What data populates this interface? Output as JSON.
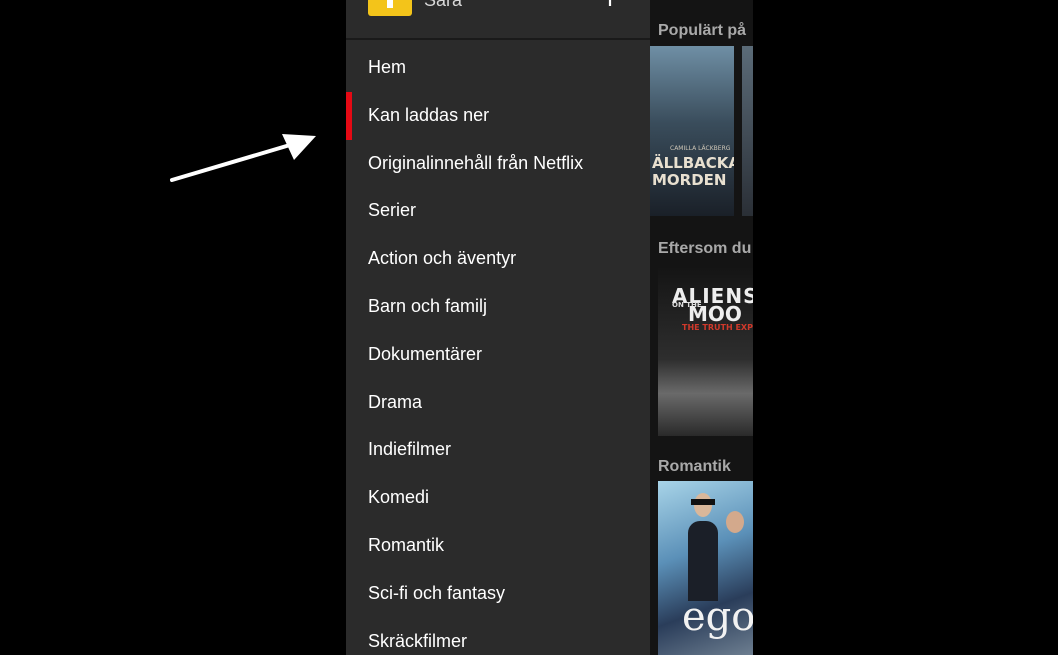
{
  "profile": {
    "name": "Sara"
  },
  "menu": {
    "items": [
      {
        "label": "Hem",
        "active": false
      },
      {
        "label": "Kan laddas ner",
        "active": true
      },
      {
        "label": "Originalinnehåll från Netflix",
        "active": false
      },
      {
        "label": "Serier",
        "active": false
      },
      {
        "label": "Action och äventyr",
        "active": false
      },
      {
        "label": "Barn och familj",
        "active": false
      },
      {
        "label": "Dokumentärer",
        "active": false
      },
      {
        "label": "Drama",
        "active": false
      },
      {
        "label": "Indiefilmer",
        "active": false
      },
      {
        "label": "Komedi",
        "active": false
      },
      {
        "label": "Romantik",
        "active": false
      },
      {
        "label": "Sci-fi och fantasy",
        "active": false
      },
      {
        "label": "Skräckfilmer",
        "active": false
      }
    ]
  },
  "content": {
    "rows": [
      {
        "title": "Populärt på"
      },
      {
        "title": "Eftersom du"
      },
      {
        "title": "Romantik"
      }
    ],
    "posters": {
      "fjallbacka": {
        "small": "CAMILLA LÄCKBERG",
        "line1": "ÄLLBACKA",
        "line2": "MORDEN"
      },
      "aliens": {
        "line1": "ALIENS",
        "on_the": "ON THE",
        "line2": "MOO",
        "sub": "THE TRUTH EXPO"
      },
      "ego": {
        "title": "ego"
      }
    }
  },
  "colors": {
    "drawer_bg": "#2b2b2b",
    "active_indicator": "#e50914",
    "avatar": "#f3c41a",
    "background": "#000000"
  },
  "icons": {
    "switch_profile": "switch-profile-icon",
    "annotation": "arrow-annotation-icon"
  }
}
